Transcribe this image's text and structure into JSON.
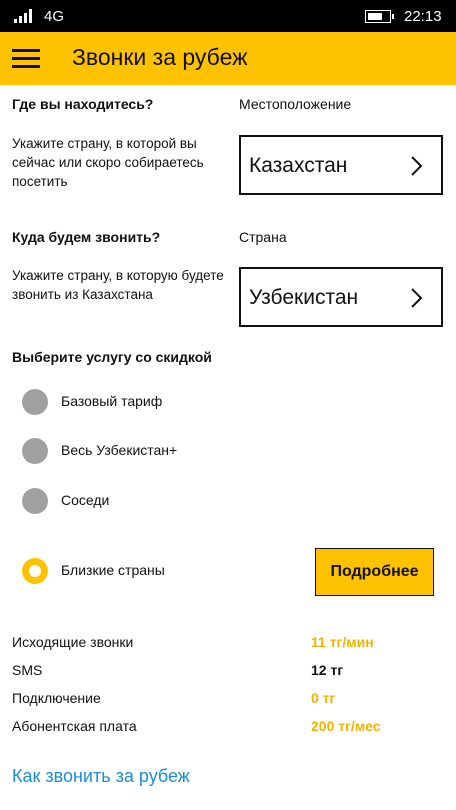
{
  "status_bar": {
    "network": "4G",
    "time": "22:13",
    "signal_icon": "signal-icon",
    "battery_icon": "battery-icon"
  },
  "header": {
    "title": "Звонки за рубеж",
    "menu_icon": "hamburger-menu-icon",
    "background_color": "#ffc200"
  },
  "location": {
    "question": "Где вы находитесь?",
    "field_label": "Местоположение",
    "hint": "Укажите страну, в которой вы сейчас или скоро собираетесь посетить",
    "value": "Казахстан"
  },
  "destination": {
    "question": "Куда будем звонить?",
    "field_label": "Страна",
    "hint": "Укажите страну, в которую будете звонить из Казахстана",
    "value": "Узбекистан"
  },
  "services": {
    "heading": "Выберите услугу со скидкой",
    "options": [
      {
        "label": "Базовый тариф",
        "selected": false
      },
      {
        "label": "Весь Узбекистан+",
        "selected": false
      },
      {
        "label": "Соседи",
        "selected": false
      },
      {
        "label": "Близкие страны",
        "selected": true
      }
    ],
    "details_button": "Подробнее"
  },
  "pricing": [
    {
      "label": "Исходящие звонки",
      "value": "11 тг/мин",
      "accent": true
    },
    {
      "label": "SMS",
      "value": "12 тг",
      "accent": false
    },
    {
      "label": "Подключение",
      "value": "0 тг",
      "accent": true
    },
    {
      "label": "Абонентская плата",
      "value": "200 тг/мес",
      "accent": true
    }
  ],
  "link": "Как звонить за рубеж",
  "colors": {
    "accent": "#ffc200",
    "accent_text": "#f0b400",
    "link": "#1a8fd6",
    "radio_off": "#a0a0a0"
  }
}
